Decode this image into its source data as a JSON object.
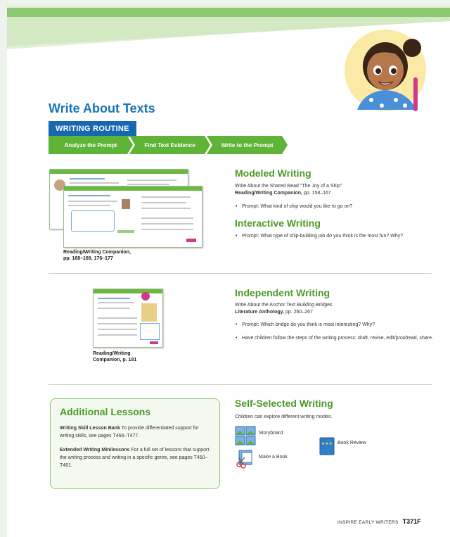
{
  "header": {
    "title": "Write About Texts"
  },
  "routine": {
    "label": "WRITING ROUTINE",
    "steps": [
      "Analyze the Prompt",
      "Find Text Evidence",
      "Write to the Prompt"
    ]
  },
  "modeled": {
    "heading": "Modeled Writing",
    "line1": "Write About the Shared Read \"The Joy of a Ship\"",
    "source_bold": "Reading/Writing Companion,",
    "source_pages": " pp. 158–167",
    "prompt": "Prompt: What kind of ship would you like to go on?",
    "caption_line1": "Reading/Writing Companion,",
    "caption_line2": "pp. 168–169, 176–177"
  },
  "interactive": {
    "heading": "Interactive Writing",
    "prompt": "Prompt: What type of ship-building job do you think is the most fun? Why?"
  },
  "independent": {
    "heading": "Independent Writing",
    "line1_prefix": "Write About the Anchor Text ",
    "line1_italic": "Building Bridges",
    "source_bold": "Literature Anthology,",
    "source_pages": " pp. 260–267",
    "prompt": "Prompt: Which bridge do you think is most interesting? Why?",
    "bullet2": "Have children follow the steps of the writing process: draft, revise, edit/proofread, share.",
    "caption_line1": "Reading/Writing",
    "caption_line2": "Companion, p. 181"
  },
  "additional": {
    "title": "Additional Lessons",
    "p1_bold": "Writing Skill Lesson Bank",
    "p1_rest": " To provide differentiated support for writing skills, see pages T468–T477.",
    "p2_bold": "Extended Writing Minilessons",
    "p2_rest": " For a full set of lessons that support the writing process and writing in a specific genre, see pages T450–T461."
  },
  "self_selected": {
    "heading": "Self-Selected Writing",
    "intro": "Children can explore different writing modes.",
    "modes": [
      {
        "label": "Storyboard",
        "icon": "storyboard-icon"
      },
      {
        "label": "Book Review",
        "icon": "book-review-icon"
      },
      {
        "label": "Make a Book",
        "icon": "make-a-book-icon"
      }
    ]
  },
  "footer": {
    "series": "INSPIRE EARLY WRITERS",
    "page": "T371F"
  },
  "colors": {
    "accent_green": "#5fb336",
    "heading_blue": "#1a73b5",
    "routine_blue": "#1668b3"
  }
}
